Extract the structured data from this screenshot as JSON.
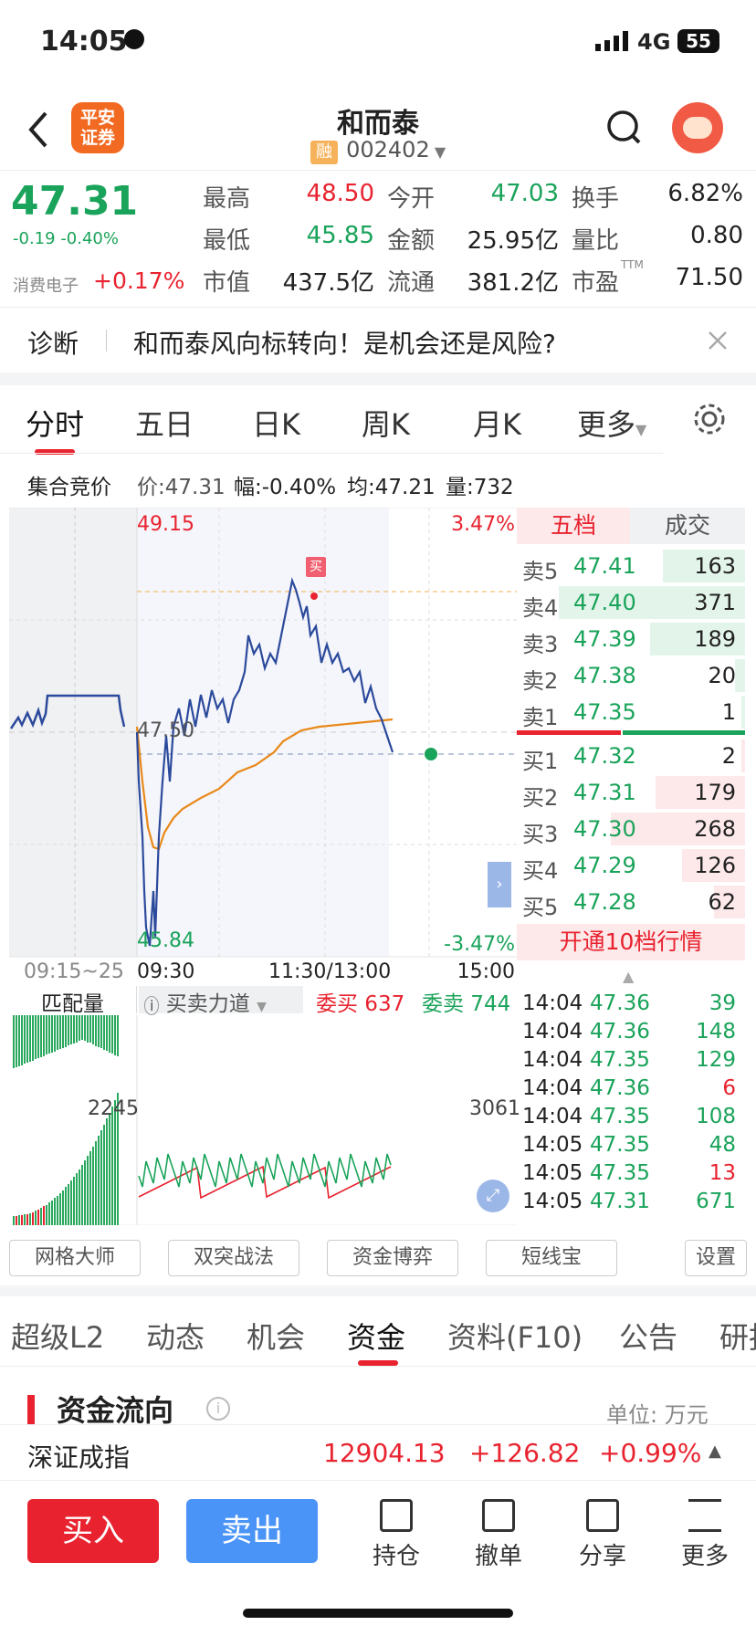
{
  "status": {
    "time": "14:05",
    "network": "4G",
    "battery": "55"
  },
  "nav": {
    "title": "和而泰",
    "badge": "融",
    "code": "002402",
    "logo_line1": "平安",
    "logo_line2": "证券"
  },
  "quote": {
    "price": "47.31",
    "change": "-0.19",
    "change_pct": "-0.40%",
    "sector_name": "消费电子",
    "sector_pct": "+0.17%",
    "high_label": "最高",
    "high": "48.50",
    "open_label": "今开",
    "open": "47.03",
    "turnover_label": "换手",
    "turnover": "6.82%",
    "low_label": "最低",
    "low": "45.85",
    "amount_label": "金额",
    "amount": "25.95亿",
    "ratio_label": "量比",
    "ratio": "0.80",
    "mktcap_label": "市值",
    "mktcap": "437.5亿",
    "float_label": "流通",
    "float": "381.2亿",
    "pe_label": "市盈",
    "pe_sup": "TTM",
    "pe": "71.50"
  },
  "diagnosis": {
    "label": "诊断",
    "text": "和而泰风向标转向！是机会还是风险?"
  },
  "chart_tabs": [
    "分时",
    "五日",
    "日K",
    "周K",
    "月K",
    "更多"
  ],
  "summary": {
    "label": "集合竞价",
    "price": "价:47.31",
    "range": "幅:-0.40%",
    "avg": "均:47.21",
    "vol_label": "量:",
    "vol": "732"
  },
  "chart_labels": {
    "top_price": "49.15",
    "mid_price": "47.50",
    "bottom_price": "45.84",
    "top_pct": "3.47%",
    "bottom_pct": "-3.47%",
    "buy_tag": "买",
    "t0": "09:15~25",
    "t1": "09:30",
    "t2": "11:30/13:00",
    "t3": "15:00"
  },
  "vol_labels": {
    "match": "匹配量",
    "power": "买卖力道",
    "bid": "委买 637",
    "ask": "委卖 744",
    "left_val": "2245",
    "right_val": "3061"
  },
  "book_tabs": {
    "five": "五档",
    "deals": "成交"
  },
  "asks": [
    {
      "label": "卖5",
      "price": "47.41",
      "vol": "163"
    },
    {
      "label": "卖4",
      "price": "47.40",
      "vol": "371"
    },
    {
      "label": "卖3",
      "price": "47.39",
      "vol": "189"
    },
    {
      "label": "卖2",
      "price": "47.38",
      "vol": "20"
    },
    {
      "label": "卖1",
      "price": "47.35",
      "vol": "1"
    }
  ],
  "bids": [
    {
      "label": "买1",
      "price": "47.32",
      "vol": "2"
    },
    {
      "label": "买2",
      "price": "47.31",
      "vol": "179"
    },
    {
      "label": "买3",
      "price": "47.30",
      "vol": "268"
    },
    {
      "label": "买4",
      "price": "47.29",
      "vol": "126"
    },
    {
      "label": "买5",
      "price": "47.28",
      "vol": "62"
    }
  ],
  "open_l2": "开通10档行情",
  "ticks": [
    {
      "time": "14:04",
      "price": "47.36",
      "vol": "39"
    },
    {
      "time": "14:04",
      "price": "47.36",
      "vol": "148"
    },
    {
      "time": "14:04",
      "price": "47.35",
      "vol": "129"
    },
    {
      "time": "14:04",
      "price": "47.36",
      "vol": "6"
    },
    {
      "time": "14:04",
      "price": "47.35",
      "vol": "108"
    },
    {
      "time": "14:05",
      "price": "47.35",
      "vol": "48"
    },
    {
      "time": "14:05",
      "price": "47.35",
      "vol": "13"
    },
    {
      "time": "14:05",
      "price": "47.31",
      "vol": "671"
    }
  ],
  "tools": [
    "网格大师",
    "双突战法",
    "资金博弈",
    "短线宝",
    "设置"
  ],
  "bottom_tabs": [
    "超级L2",
    "动态",
    "机会",
    "资金",
    "资料(F10)",
    "公告",
    "研报"
  ],
  "section": {
    "title": "资金流向",
    "unit": "单位: 万元"
  },
  "index": {
    "name": "深证成指",
    "value": "12904.13",
    "change": "+126.82",
    "pct": "+0.99%"
  },
  "actions": {
    "buy": "买入",
    "sell": "卖出",
    "hold": "持仓",
    "cancel": "撤单",
    "share": "分享",
    "more": "更多"
  },
  "colors": {
    "up": "#e8232f",
    "down": "#1aa35a",
    "price_line": "#2c4a9c",
    "avg_line": "#e8891a",
    "sell_btn": "#4a94f7"
  }
}
